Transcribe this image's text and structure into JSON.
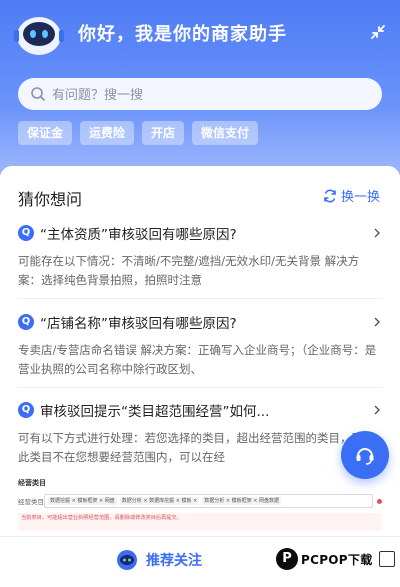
{
  "header": {
    "greeting": "你好，我是你的商家助手",
    "search_placeholder": "有问题？搜一搜",
    "chips": [
      "保证金",
      "运费险",
      "开店",
      "微信支付"
    ]
  },
  "guess": {
    "title": "猜你想问",
    "refresh_label": "换一换",
    "questions": [
      {
        "title": "“主体资质”审核驳回有哪些原因?",
        "body": "可能存在以下情况：不清晰/不完整/遮挡/无效水印/无关背景 解决方案：选择纯色背景拍照，拍照时注意"
      },
      {
        "title": "“店铺名称”审核驳回有哪些原因?",
        "body": "专卖店/专营店命名错误 解决方案：正确写入企业商号；（企业商号：是营业执照的公司名称中除行政区划、"
      },
      {
        "title": "审核驳回提示“类目超范围经营”如何...",
        "body": "可有以下方式进行处理：若您选择的类目，超出经营范围的类目，同时此类目不在您想要经营范围内，可以在经"
      }
    ]
  },
  "screenshot": {
    "section": "经营类目",
    "field_label": "经营类目",
    "tags": [
      "数据挖掘 × 模板框架 × 网盘",
      "数据分析 × 数据库挖掘 × 模板 ×",
      "数据分析 × 模板框架 × 网盘数据"
    ],
    "warning": "当前类目，可能超出营业执照经营范围，请删除或修改类目后再提交。"
  },
  "bottom": {
    "recommend_label": "推荐关注"
  },
  "watermark": {
    "letter": "P",
    "text": "PCPOP下载"
  },
  "colors": {
    "accent": "#3a6ef5",
    "header_top": "#4f7cf5",
    "header_bottom": "#9fb8fd"
  }
}
